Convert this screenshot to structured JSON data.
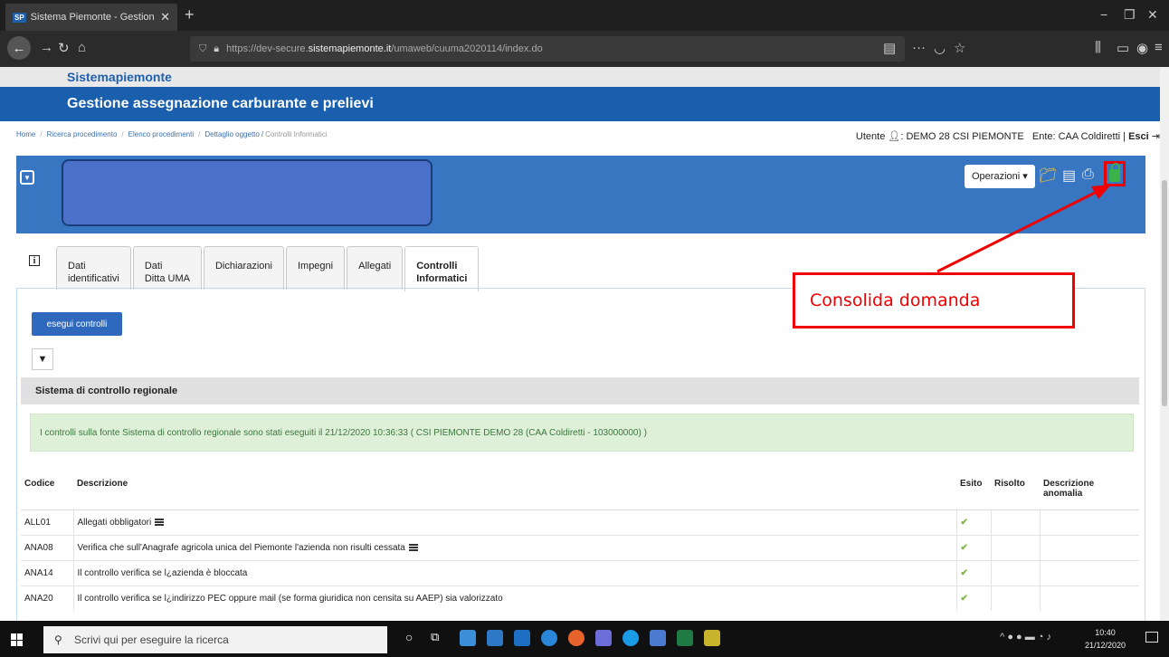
{
  "browser": {
    "tab_title": "Sistema Piemonte - Gestione a",
    "tab_favicon": "SP",
    "url_prefix": "https://dev-secure.",
    "url_domain": "sistemapiemonte.it",
    "url_path": "/umaweb/cuuma2020114/index.do"
  },
  "site": {
    "brand": "Sistemapiemonte",
    "title": "Gestione assegnazione carburante e prelievi"
  },
  "breadcrumb": [
    "Home",
    "Ricerca procedimento",
    "Elenco procedimenti",
    "Dettaglio oggetto",
    "Controlli Informatici"
  ],
  "user": {
    "label": "Utente",
    "name": "DEMO 28 CSI PIEMONTE",
    "ente_label": "Ente:",
    "ente": "CAA Coldiretti",
    "logout": "Esci"
  },
  "toolbar": {
    "operazioni": "Operazioni"
  },
  "tabs": [
    {
      "line1": "Dati",
      "line2": "identificativi"
    },
    {
      "line1": "Dati",
      "line2": "Ditta UMA"
    },
    {
      "line1": "Dichiarazioni",
      "line2": ""
    },
    {
      "line1": "Impegni",
      "line2": ""
    },
    {
      "line1": "Allegati",
      "line2": ""
    },
    {
      "line1": "Controlli",
      "line2": "Informatici"
    }
  ],
  "content": {
    "esegui_button": "esegui controlli",
    "section_title": "Sistema di controllo regionale",
    "alert": "I controlli sulla fonte Sistema di controllo regionale sono stati eseguiti il 21/12/2020 10:36:33 ( CSI PIEMONTE DEMO 28 (CAA Coldiretti - 103000000) )",
    "table": {
      "headers": [
        "Codice",
        "Descrizione",
        "Esito",
        "Risolto",
        "Descrizione anomalia"
      ],
      "rows": [
        {
          "codice": "ALL01",
          "descrizione": "Allegati obbligatori",
          "esito": "✔",
          "risolto": "",
          "anomalia": ""
        },
        {
          "codice": "ANA08",
          "descrizione": "Verifica che sull'Anagrafe agricola unica del Piemonte l'azienda non risulti cessata",
          "esito": "✔",
          "risolto": "",
          "anomalia": ""
        },
        {
          "codice": "ANA14",
          "descrizione": "Il controllo verifica se l¿azienda è bloccata",
          "esito": "✔",
          "risolto": "",
          "anomalia": ""
        },
        {
          "codice": "ANA20",
          "descrizione": "Il controllo verifica se l¿indirizzo PEC oppure mail (se forma giuridica non censita su AAEP) sia valorizzato",
          "esito": "✔",
          "risolto": "",
          "anomalia": ""
        }
      ]
    }
  },
  "annotation": {
    "text": "Consolida domanda",
    "color": "#ee0000"
  },
  "taskbar": {
    "search_placeholder": "Scrivi qui per eseguire la ricerca",
    "time": "10:40",
    "date": "21/12/2020"
  },
  "colors": {
    "header_blue": "#1a5fad",
    "panel_blue": "#3876c1",
    "success_green": "#dff0d8"
  }
}
